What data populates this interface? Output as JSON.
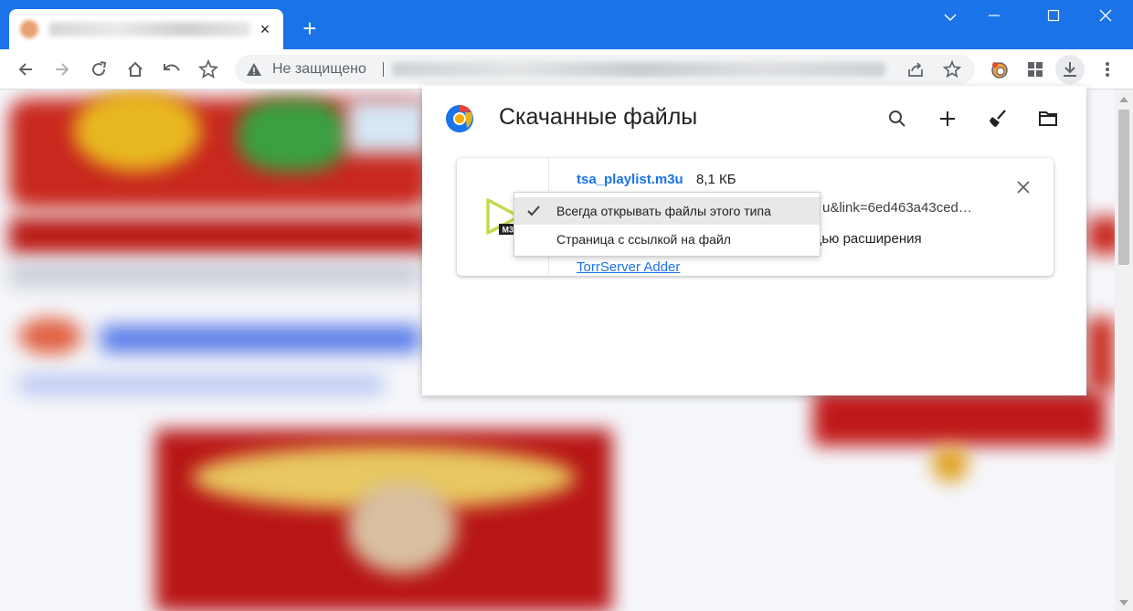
{
  "window": {
    "tab_close_glyph": "×",
    "new_tab_glyph": "+",
    "controls": [
      "⌄",
      "—",
      "☐",
      "✕"
    ]
  },
  "omnibox": {
    "security_label": "Не защищено"
  },
  "downloads": {
    "title": "Скачанные файлы",
    "actions": [
      "search-icon",
      "add-icon",
      "clear-all-icon",
      "open-folder-icon"
    ],
    "item": {
      "file_name": "tsa_playlist.m3u",
      "file_size": "8,1 КБ",
      "icon_badge": "M3U",
      "url_fragment": "u&link=6ed463a43ced…",
      "via_text": "щью расширения",
      "extension_link": "TorrServer Adder",
      "close_glyph": "×"
    }
  },
  "context_menu": {
    "items": [
      {
        "label": "Всегда открывать файлы этого типа",
        "checked": true
      },
      {
        "label": "Страница с ссылкой на файл",
        "checked": false
      }
    ]
  },
  "colors": {
    "chrome_blue": "#1a73e8",
    "link_blue": "#1a73e8",
    "icon_green": "#c6d94a"
  }
}
